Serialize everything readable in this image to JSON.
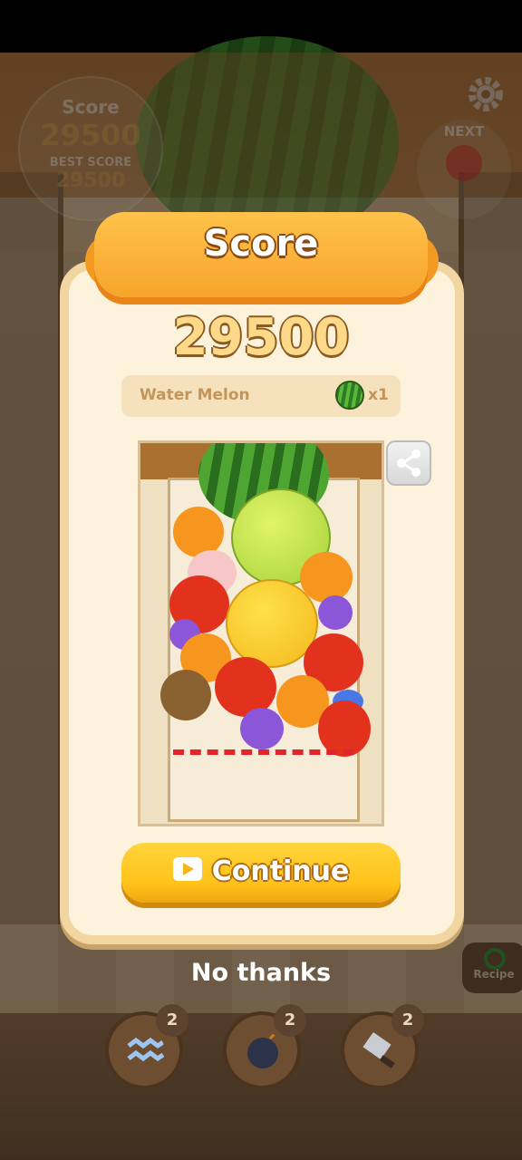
{
  "background": {
    "score_label": "Score",
    "score_value": "29500",
    "best_score_label": "BEST SCORE",
    "best_score_value": "29500",
    "next_label": "NEXT",
    "next_fruit_icon": "strawberry-icon",
    "settings_icon": "gear-icon",
    "recipe_label": "Recipe"
  },
  "dialog": {
    "title": "Score",
    "score": "29500",
    "biggest_fruit": {
      "name": "Water Melon",
      "icon": "watermelon-icon",
      "count": "x1"
    },
    "share_icon": "share-icon",
    "continue_label": "Continue",
    "continue_icon": "video-play-icon",
    "no_thanks_label": "No thanks"
  },
  "tools": [
    {
      "name": "shake",
      "icon": "wave-icon",
      "count": "2"
    },
    {
      "name": "bomb",
      "icon": "bomb-icon",
      "count": "2"
    },
    {
      "name": "cleaver",
      "icon": "cleaver-icon",
      "count": "2"
    }
  ],
  "colors": {
    "ribbon": "#f7a52c",
    "panel": "#fdf3dc",
    "continue_button": "#ffc21a",
    "deadline": "#e0262a"
  }
}
